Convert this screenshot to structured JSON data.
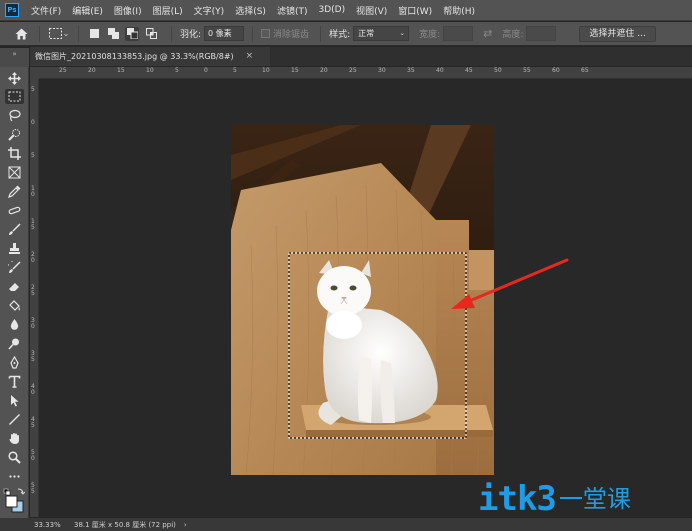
{
  "app": {
    "logo_text": "Ps"
  },
  "menu": [
    "文件(F)",
    "编辑(E)",
    "图像(I)",
    "图层(L)",
    "文字(Y)",
    "选择(S)",
    "滤镜(T)",
    "3D(D)",
    "视图(V)",
    "窗口(W)",
    "帮助(H)"
  ],
  "options": {
    "feather_label": "羽化:",
    "feather_value": "0 像素",
    "antialias_label": "消除锯齿",
    "style_label": "样式:",
    "style_value": "正常",
    "width_label": "宽度:",
    "height_label": "高度:",
    "select_mask_button": "选择并遮住 ..."
  },
  "document": {
    "tab_title": "微信图片_20210308133853.jpg @ 33.3%(RGB/8#)",
    "close_glyph": "×"
  },
  "rulers": {
    "h_ticks": [
      "25",
      "20",
      "15",
      "10",
      "5",
      "0",
      "5",
      "10",
      "15",
      "20",
      "25",
      "30",
      "35",
      "40",
      "45",
      "50",
      "55",
      "60",
      "65"
    ],
    "v_ticks": [
      "5",
      "0",
      "5",
      "1 0",
      "1 5",
      "2 0",
      "2 5",
      "3 0",
      "3 5",
      "4 0",
      "4 5",
      "5 0",
      "5 5"
    ]
  },
  "status": {
    "zoom": "33.33%",
    "doc_size": "38.1 厘米 x 50.8 厘米 (72 ppi)",
    "arrow": "›"
  },
  "watermark": {
    "logo": "itk3",
    "cn": "一堂课"
  },
  "colors": {
    "arrow": "#e8281e",
    "watermark": "#1e9de6",
    "foreground_swatch": "#ffffff",
    "background_swatch": "#a8cfe8"
  },
  "icons": [
    "home-icon",
    "rect-marquee-icon",
    "move-icon",
    "lasso-icon",
    "quick-select-icon",
    "crop-icon",
    "frame-icon",
    "eyedropper-icon",
    "healing-icon",
    "brush-icon",
    "stamp-icon",
    "history-brush-icon",
    "eraser-icon",
    "paint-bucket-icon",
    "blur-icon",
    "dodge-icon",
    "pen-icon",
    "type-icon",
    "path-select-icon",
    "line-icon",
    "hand-icon",
    "zoom-icon",
    "more-tools-icon",
    "swap-colors-icon"
  ]
}
